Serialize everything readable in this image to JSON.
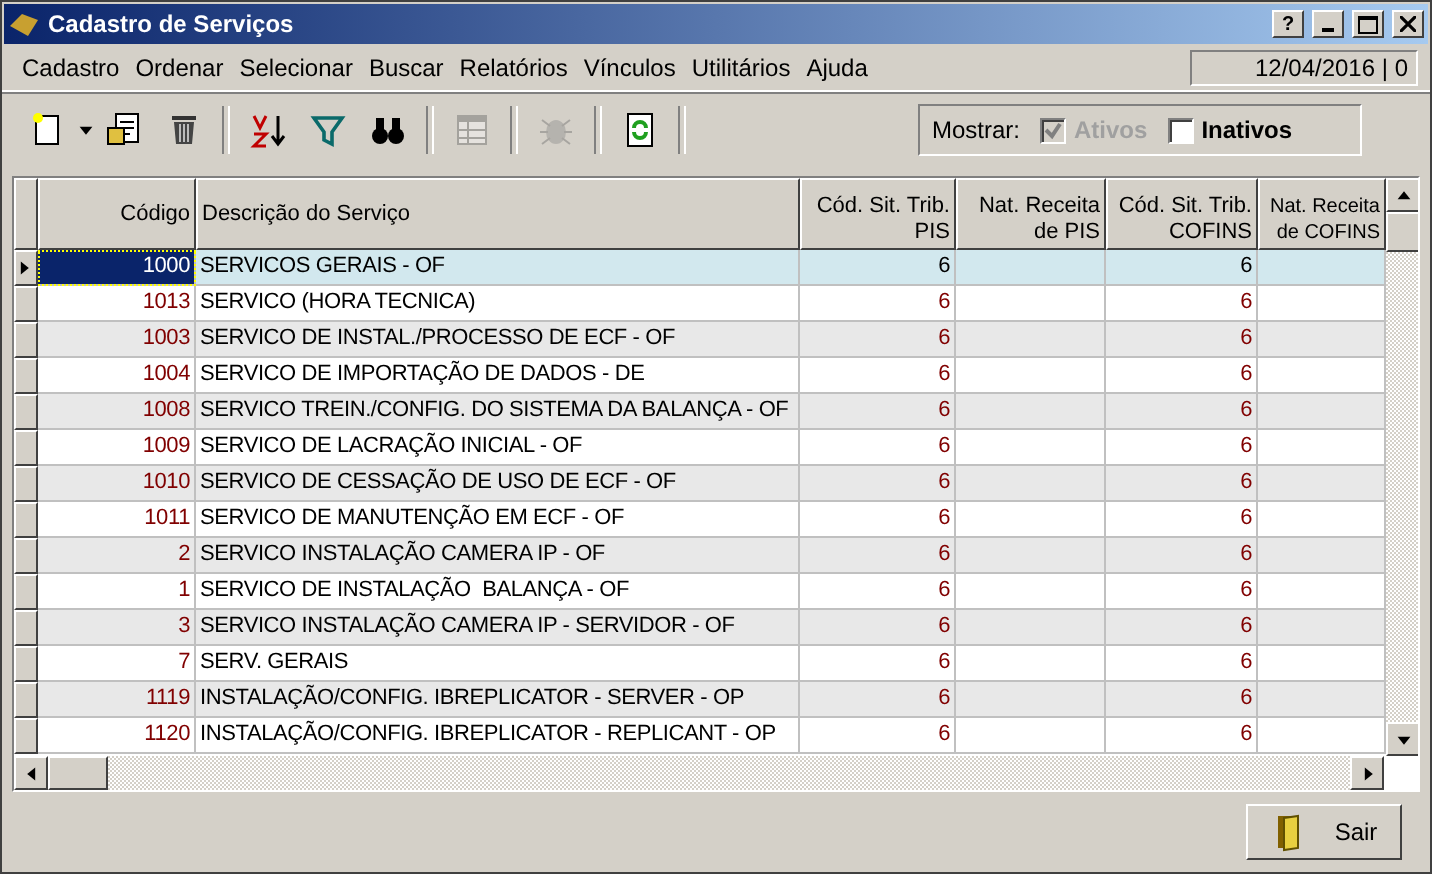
{
  "window": {
    "title": "Cadastro de Serviços"
  },
  "help_button": "?",
  "menu": [
    {
      "label": "Cadastro"
    },
    {
      "label": "Ordenar"
    },
    {
      "label": "Selecionar"
    },
    {
      "label": "Buscar"
    },
    {
      "label": "Relatórios"
    },
    {
      "label": "Vínculos"
    },
    {
      "label": "Utilitários"
    },
    {
      "label": "Ajuda"
    }
  ],
  "status": "12/04/2016 | 0",
  "toolbar": [
    {
      "kind": "new",
      "disabled": false
    },
    {
      "kind": "edit",
      "disabled": false
    },
    {
      "kind": "delete",
      "disabled": false
    },
    {
      "kind": "sep"
    },
    {
      "kind": "sort",
      "disabled": false
    },
    {
      "kind": "filter",
      "disabled": false
    },
    {
      "kind": "find",
      "disabled": false
    },
    {
      "kind": "sep"
    },
    {
      "kind": "grid",
      "disabled": true
    },
    {
      "kind": "sep"
    },
    {
      "kind": "bug",
      "disabled": true
    },
    {
      "kind": "sep"
    },
    {
      "kind": "refresh",
      "disabled": false
    }
  ],
  "filter": {
    "label": "Mostrar:",
    "options": [
      {
        "label": "Ativos",
        "checked": true,
        "disabled": true
      },
      {
        "label": "Inativos",
        "checked": false,
        "disabled": false
      }
    ]
  },
  "table": {
    "columns": [
      "Código",
      "Descrição do Serviço",
      "Cód. Sit. Trib. PIS",
      "Nat. Receita de PIS",
      "Cód. Sit. Trib. COFINS",
      "Nat. Receita de COFINS"
    ],
    "rows": [
      {
        "code": "1000",
        "description": "SERVICOS GERAIS - OF",
        "pis": "6",
        "cofins": "6",
        "selected": true
      },
      {
        "code": "1013",
        "description": "SERVICO (HORA TECNICA)",
        "pis": "6",
        "cofins": "6",
        "selected": false
      },
      {
        "code": "1003",
        "description": "SERVICO DE INSTAL./PROCESSO DE ECF - OF",
        "pis": "6",
        "cofins": "6",
        "selected": false
      },
      {
        "code": "1004",
        "description": "SERVICO DE IMPORTAÇÃO DE DADOS - DE",
        "pis": "6",
        "cofins": "6",
        "selected": false
      },
      {
        "code": "1008",
        "description": "SERVICO TREIN./CONFIG. DO SISTEMA DA BALANÇA - OF",
        "pis": "6",
        "cofins": "6",
        "selected": false
      },
      {
        "code": "1009",
        "description": "SERVICO DE LACRAÇÃO INICIAL - OF",
        "pis": "6",
        "cofins": "6",
        "selected": false
      },
      {
        "code": "1010",
        "description": "SERVICO DE CESSAÇÃO DE USO DE ECF - OF",
        "pis": "6",
        "cofins": "6",
        "selected": false
      },
      {
        "code": "1011",
        "description": "SERVICO DE MANUTENÇÃO EM ECF - OF",
        "pis": "6",
        "cofins": "6",
        "selected": false
      },
      {
        "code": "2",
        "description": "SERVICO INSTALAÇÃO CAMERA IP - OF",
        "pis": "6",
        "cofins": "6",
        "selected": false
      },
      {
        "code": "1",
        "description": "SERVICO DE INSTALAÇÃO  BALANÇA - OF",
        "pis": "6",
        "cofins": "6",
        "selected": false
      },
      {
        "code": "3",
        "description": "SERVICO INSTALAÇÃO CAMERA IP - SERVIDOR - OF",
        "pis": "6",
        "cofins": "6",
        "selected": false
      },
      {
        "code": "7",
        "description": "SERV. GERAIS",
        "pis": "6",
        "cofins": "6",
        "selected": false
      },
      {
        "code": "1119",
        "description": "INSTALAÇÃO/CONFIG. IBREPLICATOR - SERVER - OP",
        "pis": "6",
        "cofins": "6",
        "selected": false
      },
      {
        "code": "1120",
        "description": "INSTALAÇÃO/CONFIG. IBREPLICATOR - REPLICANT - OP",
        "pis": "6",
        "cofins": "6",
        "selected": false
      }
    ]
  },
  "exit_button": "Sair"
}
